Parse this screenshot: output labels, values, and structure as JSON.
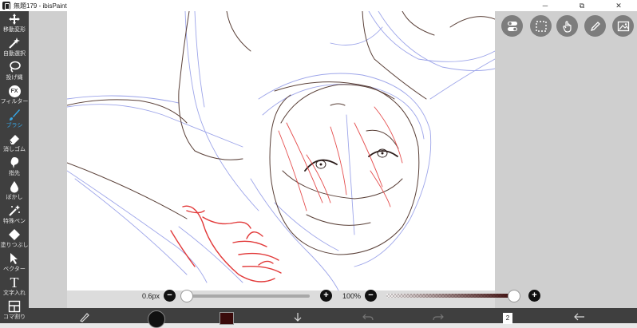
{
  "window": {
    "title": "無題179 - ibisPaint",
    "minimize": "─",
    "maximize": "⧉",
    "close": "✕"
  },
  "tools": [
    {
      "label": "移動変形",
      "icon": "move-transform-icon"
    },
    {
      "label": "自動選択",
      "icon": "magic-wand-icon"
    },
    {
      "label": "投げ縄",
      "icon": "lasso-icon"
    },
    {
      "label": "フィルター",
      "icon": "fx-filter-icon",
      "glyph": "FX"
    },
    {
      "label": "ブラシ",
      "icon": "brush-icon",
      "active": true
    },
    {
      "label": "消しゴム",
      "icon": "eraser-icon"
    },
    {
      "label": "指先",
      "icon": "smudge-icon"
    },
    {
      "label": "ぼかし",
      "icon": "blur-drop-icon"
    },
    {
      "label": "特殊ペン",
      "icon": "special-pen-icon"
    },
    {
      "label": "塗りつぶし",
      "icon": "bucket-fill-icon"
    },
    {
      "label": "ベクター",
      "icon": "vector-icon"
    },
    {
      "label": "文字入れ",
      "icon": "text-icon",
      "glyph": "T"
    },
    {
      "label": "コマ割り",
      "icon": "frame-divider-icon"
    }
  ],
  "brush_size": {
    "value": "0.6px",
    "minus": "−",
    "plus": "+",
    "level": 0.0
  },
  "opacity": {
    "value": "100%",
    "minus": "−",
    "plus": "+",
    "level": 1.0
  },
  "layer_count": "2",
  "colors": {
    "accent": "#37a8e8",
    "toolbar_bg": "#3f3f3f",
    "current_color": "#3a0a0a",
    "sketch_brown": "#5a4038",
    "sketch_blue": "#8d96e6",
    "sketch_red": "#e23a3a"
  }
}
